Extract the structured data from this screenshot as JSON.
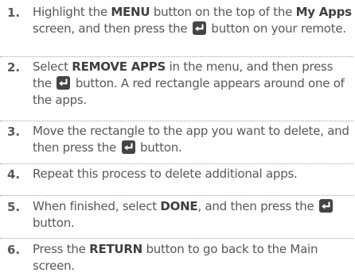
{
  "steps": [
    {
      "num": "1.",
      "parts": [
        {
          "t": "Highlight the "
        },
        {
          "t": "MENU",
          "b": true
        },
        {
          "t": " button on the top of the "
        },
        {
          "t": "My Apps",
          "b": true
        },
        {
          "t": " screen, and then press the "
        },
        {
          "icon": "enter-icon"
        },
        {
          "t": " button on your remote."
        }
      ]
    },
    {
      "num": "2.",
      "parts": [
        {
          "t": "Select "
        },
        {
          "t": "REMOVE APPS",
          "b": true
        },
        {
          "t": " in the menu, and then press the "
        },
        {
          "icon": "enter-icon"
        },
        {
          "t": " button. A red rectangle appears around one of the apps."
        }
      ]
    },
    {
      "num": "3.",
      "parts": [
        {
          "t": "Move the rectangle to the app you want to delete, and then press the "
        },
        {
          "icon": "enter-icon"
        },
        {
          "t": " button."
        }
      ]
    },
    {
      "num": "4.",
      "parts": [
        {
          "t": "Repeat this process to delete additional apps."
        }
      ]
    },
    {
      "num": "5.",
      "parts": [
        {
          "t": "When finished, select "
        },
        {
          "t": "DONE",
          "b": true
        },
        {
          "t": ", and then press the "
        },
        {
          "icon": "enter-icon"
        },
        {
          "t": " button."
        }
      ]
    },
    {
      "num": "6.",
      "parts": [
        {
          "t": "Press the "
        },
        {
          "t": "RETURN",
          "b": true
        },
        {
          "t": " button to go back to the Main screen."
        }
      ]
    }
  ],
  "colors": {
    "text": "#58585a",
    "bold": "#3f3f41",
    "icon_bg": "#444446"
  }
}
